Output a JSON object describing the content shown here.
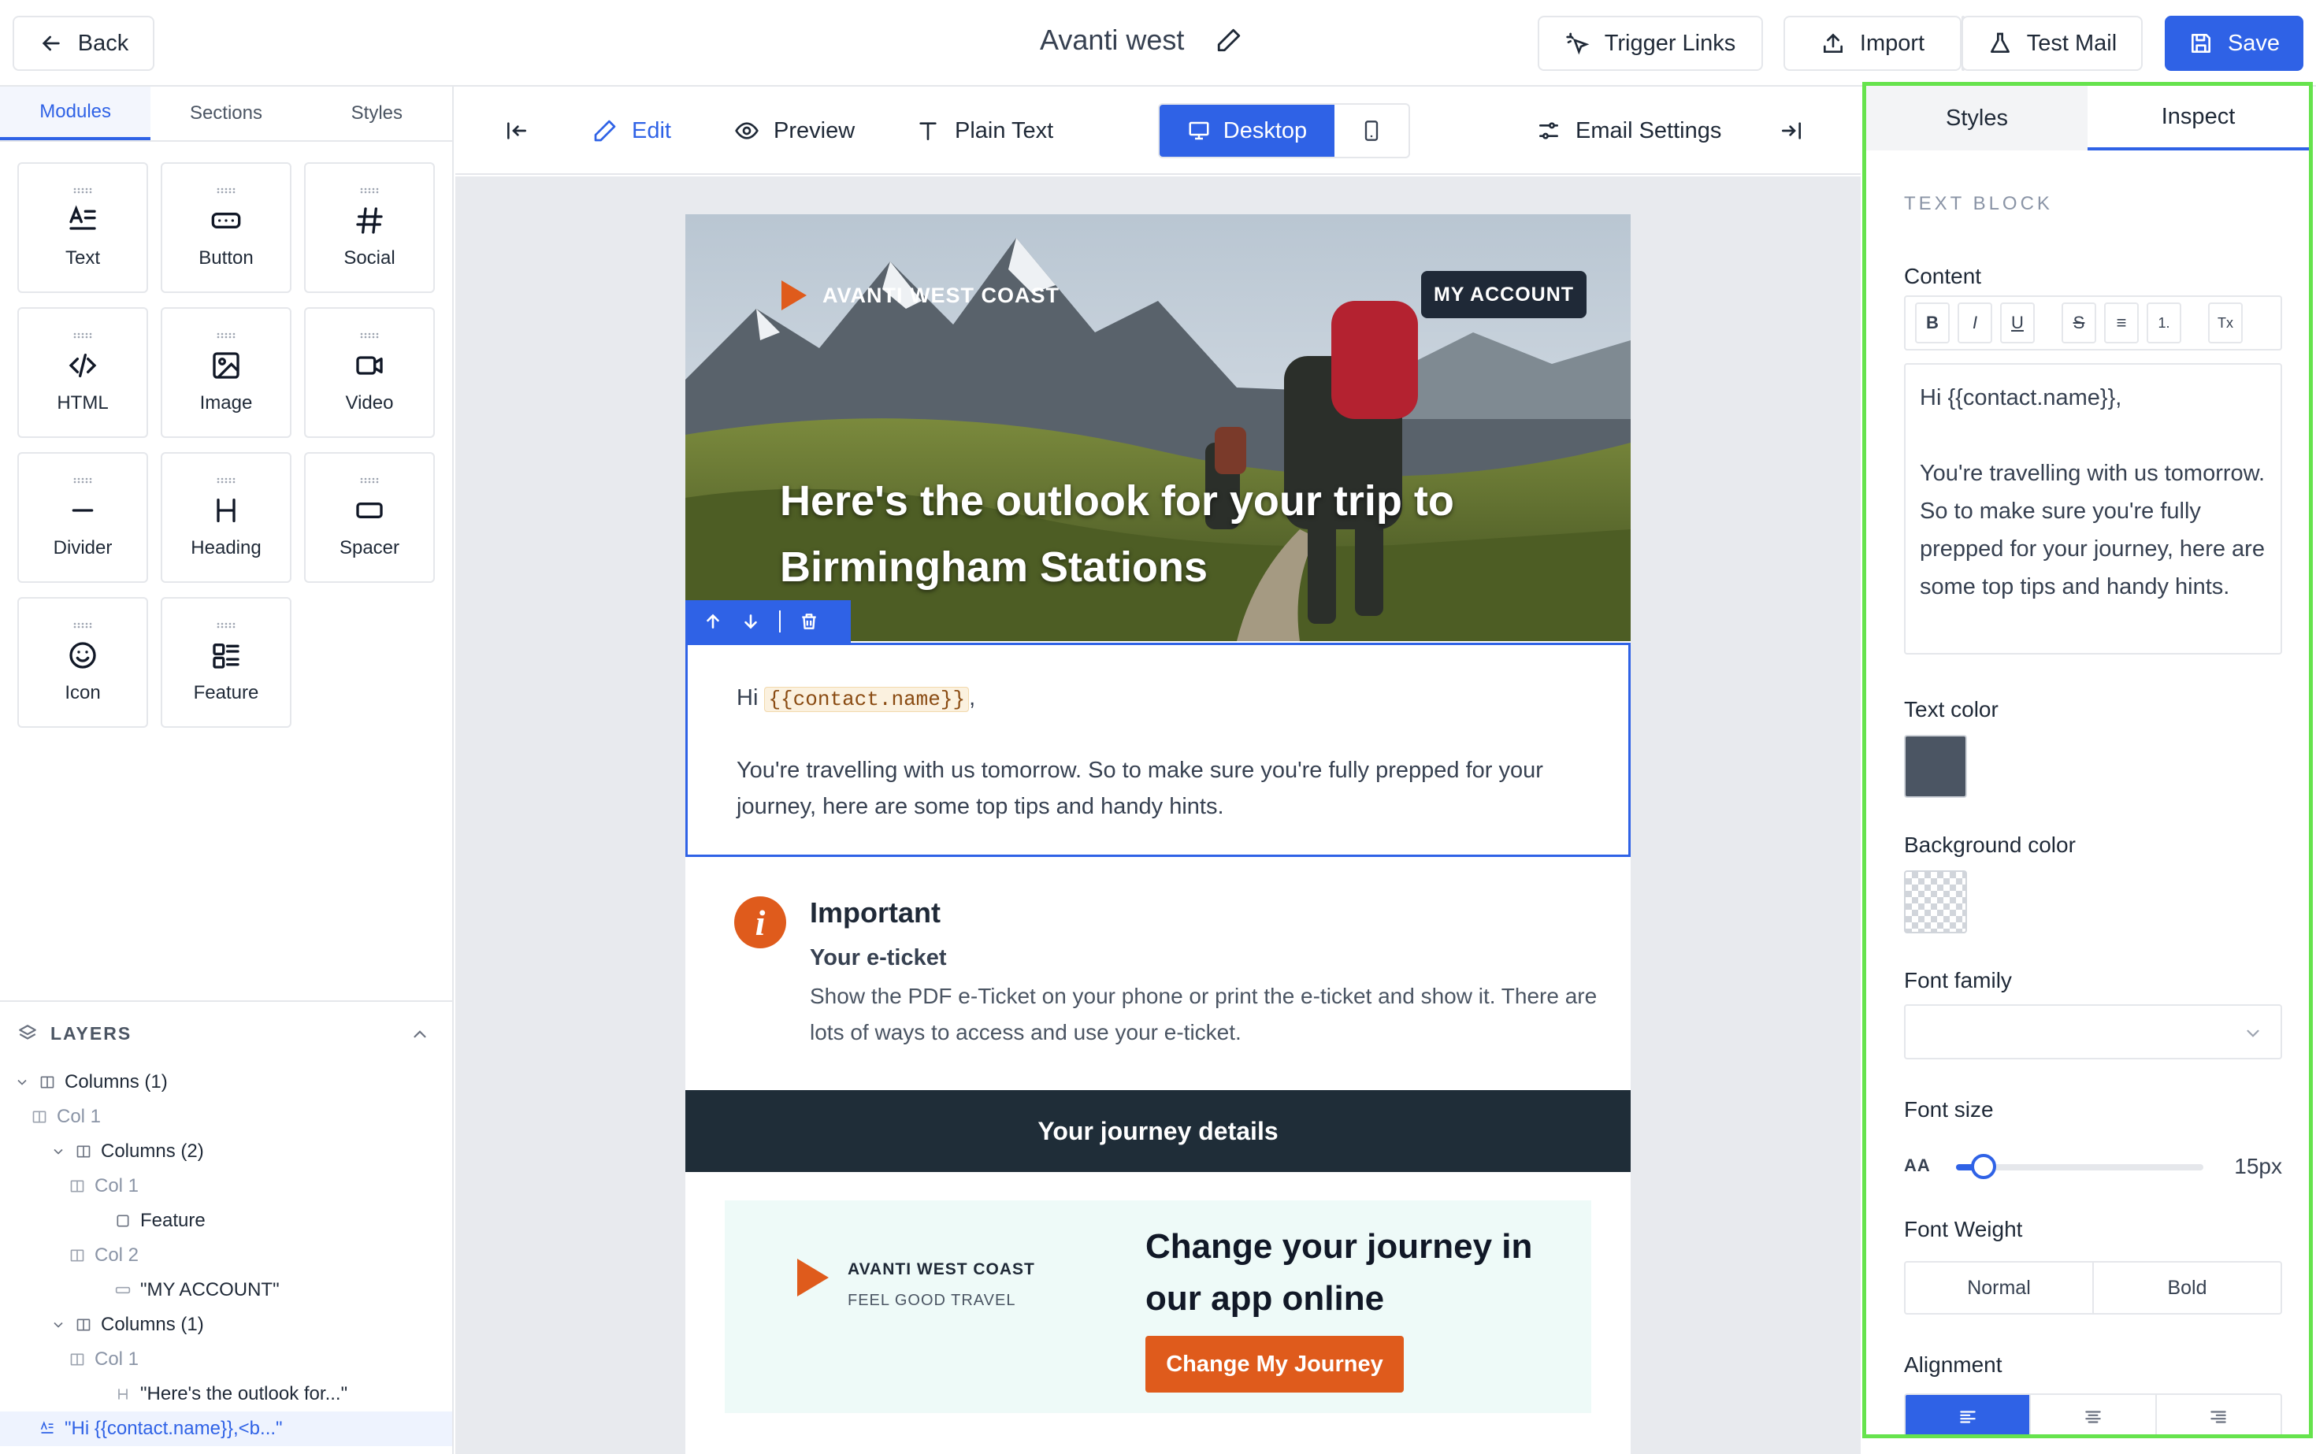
{
  "topbar": {
    "back_label": "Back",
    "doc_title": "Avanti west",
    "trigger_links_label": "Trigger Links",
    "import_label": "Import",
    "test_mail_label": "Test Mail",
    "save_label": "Save"
  },
  "left_sidebar": {
    "tabs": [
      "Modules",
      "Sections",
      "Styles"
    ],
    "active_tab": "Modules",
    "modules": [
      {
        "label": "Text",
        "icon": "text-icon"
      },
      {
        "label": "Button",
        "icon": "button-icon"
      },
      {
        "label": "Social",
        "icon": "hash-icon"
      },
      {
        "label": "HTML",
        "icon": "code-icon"
      },
      {
        "label": "Image",
        "icon": "image-icon"
      },
      {
        "label": "Video",
        "icon": "video-icon"
      },
      {
        "label": "Divider",
        "icon": "divider-icon"
      },
      {
        "label": "Heading",
        "icon": "heading-icon"
      },
      {
        "label": "Spacer",
        "icon": "spacer-icon"
      },
      {
        "label": "Icon",
        "icon": "smiley-icon"
      },
      {
        "label": "Feature",
        "icon": "feature-icon"
      }
    ],
    "layers": {
      "title": "LAYERS",
      "items": [
        {
          "label": "Columns (1)"
        },
        {
          "label": "Col 1"
        },
        {
          "label": "Columns (2)"
        },
        {
          "label": "Col 1"
        },
        {
          "label": "Feature"
        },
        {
          "label": "Col 2"
        },
        {
          "label": "\"MY ACCOUNT\""
        },
        {
          "label": "Columns (1)"
        },
        {
          "label": "Col 1"
        },
        {
          "label": "\"Here's the outlook for...\""
        },
        {
          "label": "\"Hi {{contact.name}},<b...\""
        }
      ]
    }
  },
  "center_toolbar": {
    "edit_label": "Edit",
    "preview_label": "Preview",
    "plain_text_label": "Plain Text",
    "desktop_label": "Desktop",
    "email_settings_label": "Email Settings"
  },
  "email": {
    "brand": "AVANTI WEST COAST",
    "my_account": "MY ACCOUNT",
    "headline": "Here's the outlook for your trip to Birmingham Stations",
    "greeting_prefix": "Hi ",
    "greeting_tag": "{{contact.name}}",
    "greeting_suffix": ",",
    "intro": "You're travelling with us tomorrow. So to make sure you're fully prepped for your journey, here are some top tips and handy hints.",
    "important_title": "Important",
    "important_subtitle": "Your e-ticket",
    "important_body": "Show the PDF e-Ticket on your phone or print the e-ticket and show it. There are lots of ways to access and use your e-ticket.",
    "journey_bar": "Your journey details",
    "app_brand": "AVANTI WEST COAST",
    "app_tagline": "FEEL GOOD TRAVEL",
    "app_headline": "Change your journey in our app online",
    "app_cta": "Change My Journey",
    "colors": {
      "orange": "#df5b1c",
      "dark_bar": "#1f2d38",
      "app_bg": "#eefaf8"
    }
  },
  "inspector": {
    "tabs": [
      "Styles",
      "Inspect"
    ],
    "active_tab": "Inspect",
    "section": "TEXT BLOCK",
    "content_label": "Content",
    "rte_buttons": [
      "B",
      "I",
      "U",
      "S",
      "≡",
      "1.",
      "Tx"
    ],
    "editor_greeting": "Hi {{contact.name}},",
    "editor_body": "You're travelling with us tomorrow. So to make sure you're fully prepped for your journey, here are some top tips and handy hints.",
    "text_color_label": "Text color",
    "text_color": "#4b5563",
    "bg_color_label": "Background color",
    "font_family_label": "Font family",
    "font_family_value": "",
    "font_size_label": "Font size",
    "font_size_glyph": "AA",
    "font_size_value": "15px",
    "font_size_slider_fraction": 0.11,
    "font_weight_label": "Font Weight",
    "font_weight_options": [
      "Normal",
      "Bold"
    ],
    "alignment_label": "Alignment",
    "alignment_selected": "left"
  }
}
